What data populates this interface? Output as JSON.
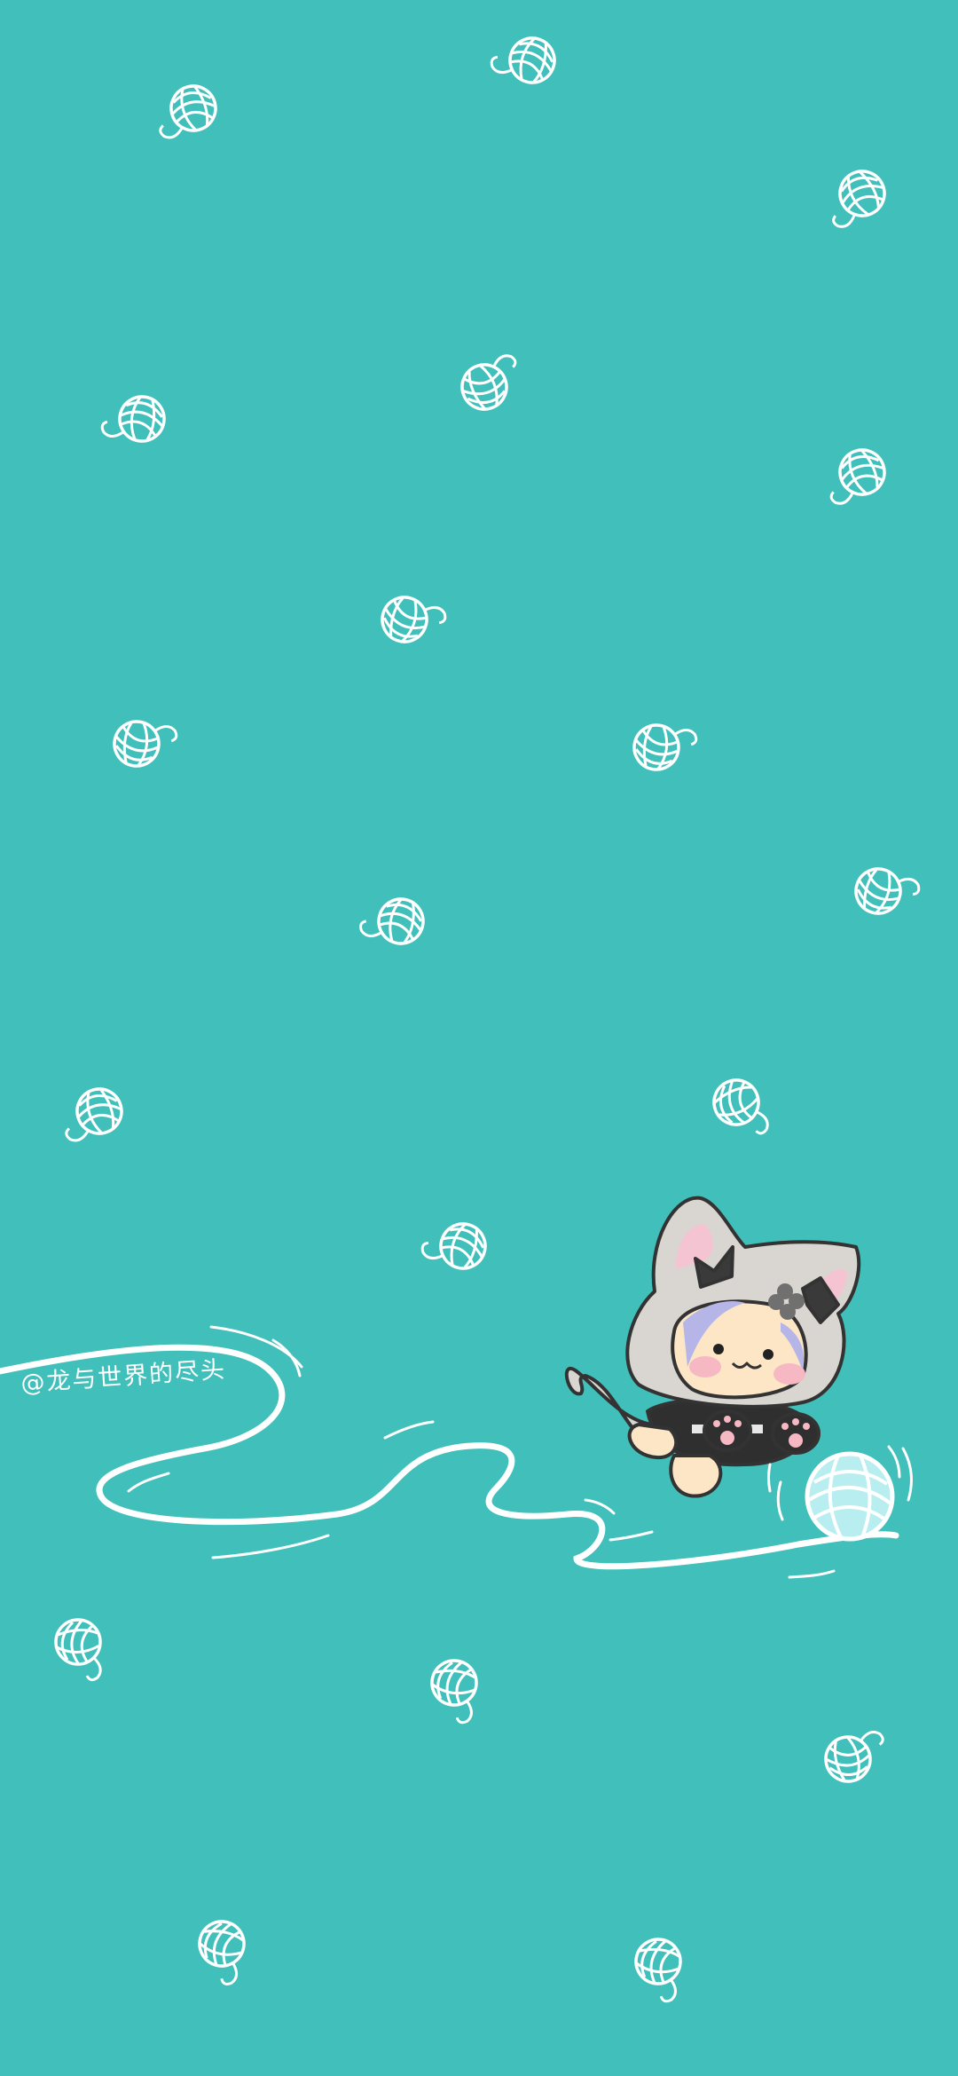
{
  "background_color": "#41c0bb",
  "line_color": "#ffffff",
  "credit": "@龙与世界的尽头",
  "character": {
    "hood_color": "#d9d6d1",
    "outline_color": "#333333",
    "skin_color": "#fde6c6",
    "hair_accent_color": "#b5b5e8",
    "yarn_color": "#b9eef0"
  }
}
